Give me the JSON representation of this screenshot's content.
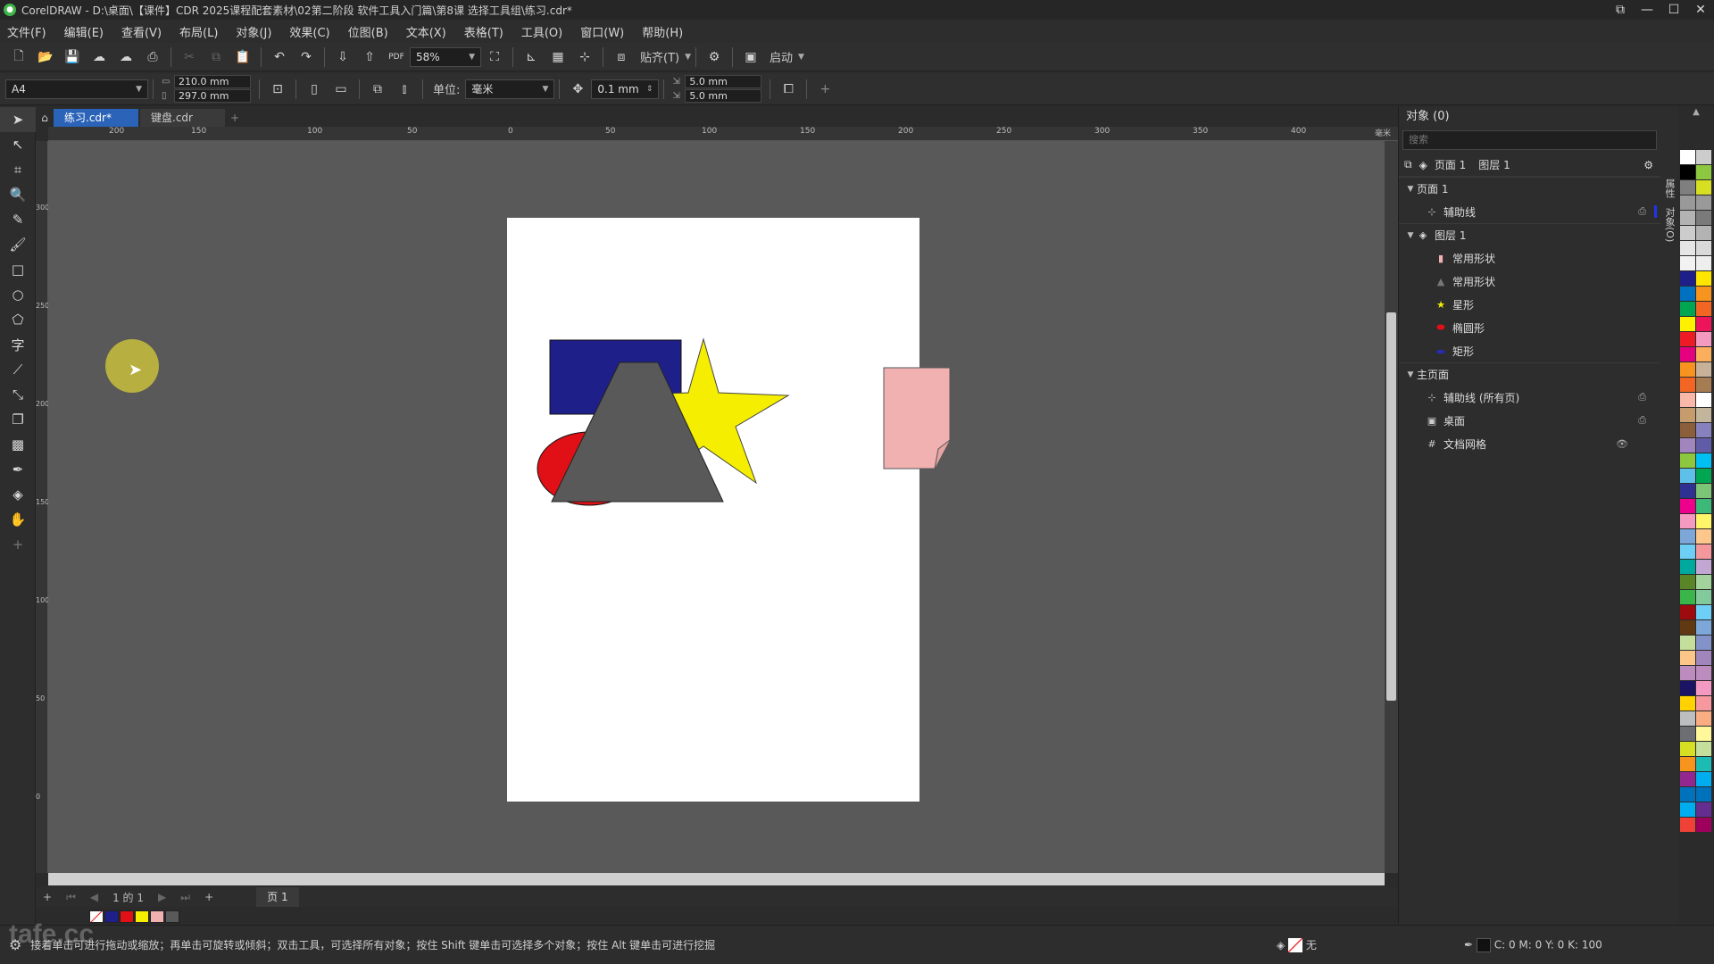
{
  "title": "CorelDRAW - D:\\桌面\\【课件】CDR 2025课程配套素材\\02第二阶段 软件工具入门篇\\第8课 选择工具组\\练习.cdr*",
  "menu": [
    "文件(F)",
    "编辑(E)",
    "查看(V)",
    "布局(L)",
    "对象(J)",
    "效果(C)",
    "位图(B)",
    "文本(X)",
    "表格(T)",
    "工具(O)",
    "窗口(W)",
    "帮助(H)"
  ],
  "toolbar": {
    "zoom": "58%",
    "snap_label": "贴齐(T)",
    "launch_label": "启动"
  },
  "propbar": {
    "page_size": "A4",
    "width": "210.0 mm",
    "height": "297.0 mm",
    "unit_label": "单位:",
    "unit": "毫米",
    "nudge": "0.1 mm",
    "dup_x": "5.0 mm",
    "dup_y": "5.0 mm"
  },
  "tabs": [
    "练习.cdr*",
    "键盘.cdr"
  ],
  "ruler_h": [
    "200",
    "150",
    "100",
    "50",
    "0",
    "50",
    "100",
    "150",
    "200",
    "250",
    "300",
    "350",
    "400",
    "毫米"
  ],
  "ruler_v": [
    "300",
    "250",
    "200",
    "150",
    "100",
    "50",
    "0"
  ],
  "pagebar": {
    "count": "1 的 1",
    "page_tab": "页 1"
  },
  "status_hint": "接着单击可进行拖动或缩放；再单击可旋转或倾斜；双击工具，可选择所有对象；按住 Shift 键单击可选择多个对象；按住 Alt 键单击可进行挖掘",
  "fill_label": "无",
  "color_info": "C: 0 M: 0 Y: 0 K: 100",
  "objects_panel": {
    "title": "对象 (0)",
    "search_placeholder": "搜索",
    "page_label": "页面 1",
    "layer_label": "图层 1",
    "rows": [
      {
        "label": "页面 1",
        "level": 0,
        "icon": "expand"
      },
      {
        "label": "辅助线",
        "level": 1,
        "icon": "guides"
      },
      {
        "label": "图层 1",
        "level": 0,
        "icon": "layer"
      },
      {
        "label": "常用形状",
        "level": 2,
        "icon": "pink-shape"
      },
      {
        "label": "常用形状",
        "level": 2,
        "icon": "gray-shape"
      },
      {
        "label": "星形",
        "level": 2,
        "icon": "star"
      },
      {
        "label": "椭圆形",
        "level": 2,
        "icon": "ellipse"
      },
      {
        "label": "矩形",
        "level": 2,
        "icon": "rectangle"
      },
      {
        "label": "主页面",
        "level": 0,
        "icon": "expand"
      },
      {
        "label": "辅助线 (所有页)",
        "level": 1,
        "icon": "guides"
      },
      {
        "label": "桌面",
        "level": 1,
        "icon": "desktop"
      },
      {
        "label": "文档网格",
        "level": 1,
        "icon": "grid"
      }
    ]
  },
  "side_tabs": [
    "属性",
    "对象(O)"
  ],
  "watermark": "tafe.cc",
  "colors": {
    "rect": "#1f1f8a",
    "ellipse": "#e01016",
    "trapezoid": "#595959",
    "star": "#f5ee00",
    "pink": "#f1b1b1",
    "accent": "#2a63b8"
  }
}
